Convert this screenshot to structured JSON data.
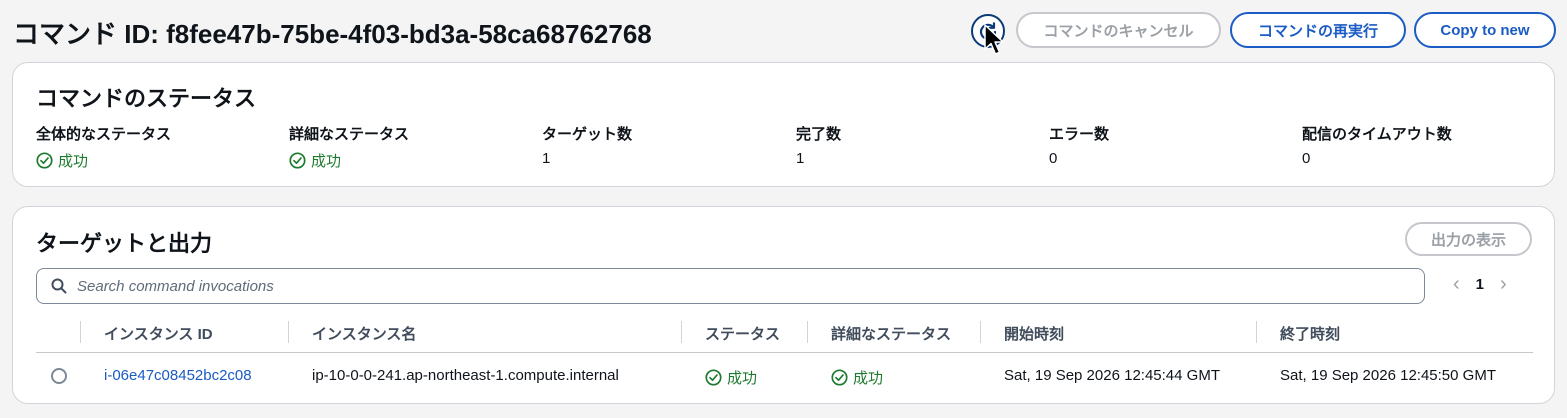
{
  "header": {
    "title": "コマンド ID: f8fee47b-75be-4f03-bd3a-58ca68762768",
    "cancel_label": "コマンドのキャンセル",
    "rerun_label": "コマンドの再実行",
    "copy_label": "Copy to new"
  },
  "status_panel": {
    "title": "コマンドのステータス",
    "stats": [
      {
        "label": "全体的なステータス",
        "value": "成功"
      },
      {
        "label": "詳細なステータス",
        "value": "成功"
      },
      {
        "label": "ターゲット数",
        "value": "1"
      },
      {
        "label": "完了数",
        "value": "1"
      },
      {
        "label": "エラー数",
        "value": "0"
      },
      {
        "label": "配信のタイムアウト数",
        "value": "0"
      }
    ]
  },
  "targets_panel": {
    "title": "ターゲットと出力",
    "output_label": "出力の表示",
    "search_placeholder": "Search command invocations",
    "page": "1",
    "columns": [
      "インスタンス ID",
      "インスタンス名",
      "ステータス",
      "詳細なステータス",
      "開始時刻",
      "終了時刻"
    ],
    "rows": [
      {
        "instance_id": "i-06e47c08452bc2c08",
        "instance_name": "ip-10-0-0-241.ap-northeast-1.compute.internal",
        "status": "成功",
        "detailed_status": "成功",
        "start": "Sat, 19 Sep 2026 12:45:44 GMT",
        "end": "Sat, 19 Sep 2026 12:45:50 GMT"
      }
    ]
  },
  "colors": {
    "success": "#1d7a2e",
    "link": "#1a5bc4"
  }
}
